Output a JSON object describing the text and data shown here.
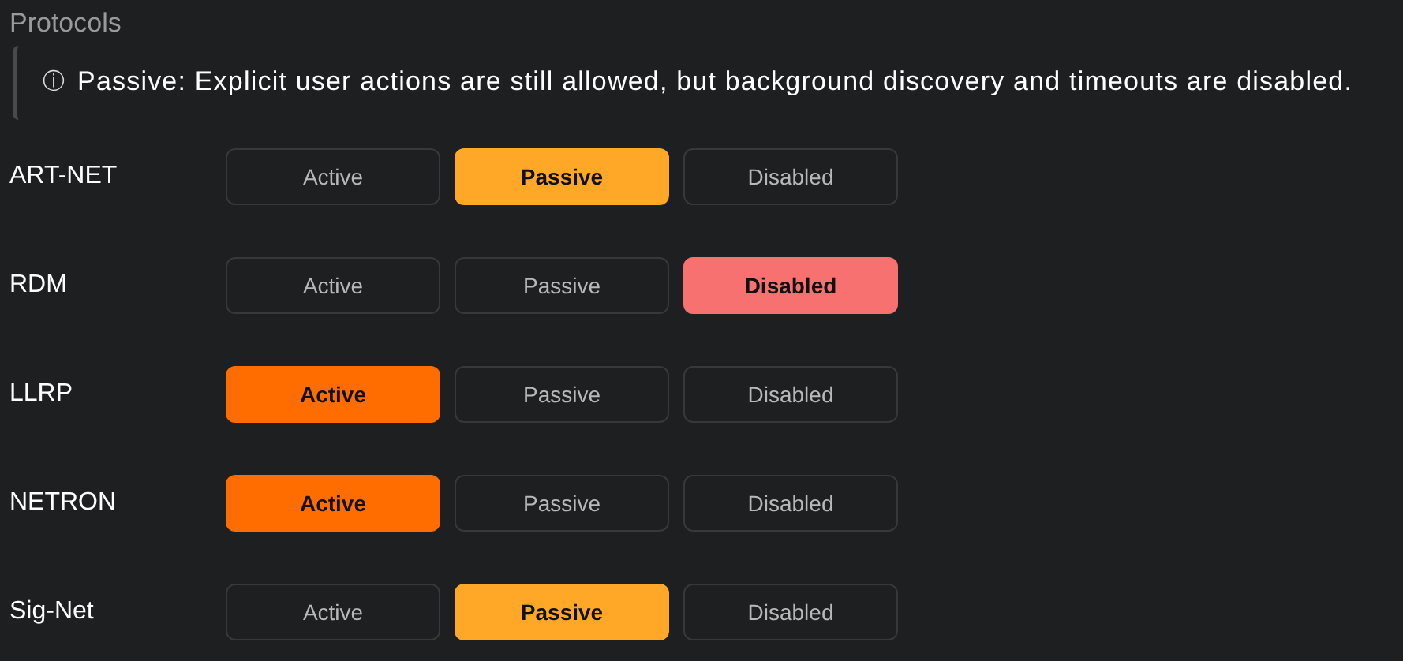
{
  "section": {
    "title": "Protocols"
  },
  "callout": {
    "icon": "ⓘ",
    "text": "Passive: Explicit user actions are still allowed, but background discovery and timeouts are disabled."
  },
  "protocols": [
    {
      "name": "ART-NET",
      "options": [
        {
          "label": "Active",
          "kind": "active",
          "selected": false
        },
        {
          "label": "Passive",
          "kind": "passive",
          "selected": true
        },
        {
          "label": "Disabled",
          "kind": "disabled",
          "selected": false
        }
      ]
    },
    {
      "name": "RDM",
      "options": [
        {
          "label": "Active",
          "kind": "active",
          "selected": false
        },
        {
          "label": "Passive",
          "kind": "passive",
          "selected": false
        },
        {
          "label": "Disabled",
          "kind": "disabled",
          "selected": true
        }
      ]
    },
    {
      "name": "LLRP",
      "options": [
        {
          "label": "Active",
          "kind": "active",
          "selected": true
        },
        {
          "label": "Passive",
          "kind": "passive",
          "selected": false
        },
        {
          "label": "Disabled",
          "kind": "disabled",
          "selected": false
        }
      ]
    },
    {
      "name": "NETRON",
      "options": [
        {
          "label": "Active",
          "kind": "active",
          "selected": true
        },
        {
          "label": "Passive",
          "kind": "passive",
          "selected": false
        },
        {
          "label": "Disabled",
          "kind": "disabled",
          "selected": false
        }
      ]
    },
    {
      "name": "Sig-Net",
      "options": [
        {
          "label": "Active",
          "kind": "active",
          "selected": false
        },
        {
          "label": "Passive",
          "kind": "passive",
          "selected": true
        },
        {
          "label": "Disabled",
          "kind": "disabled",
          "selected": false
        }
      ]
    }
  ]
}
